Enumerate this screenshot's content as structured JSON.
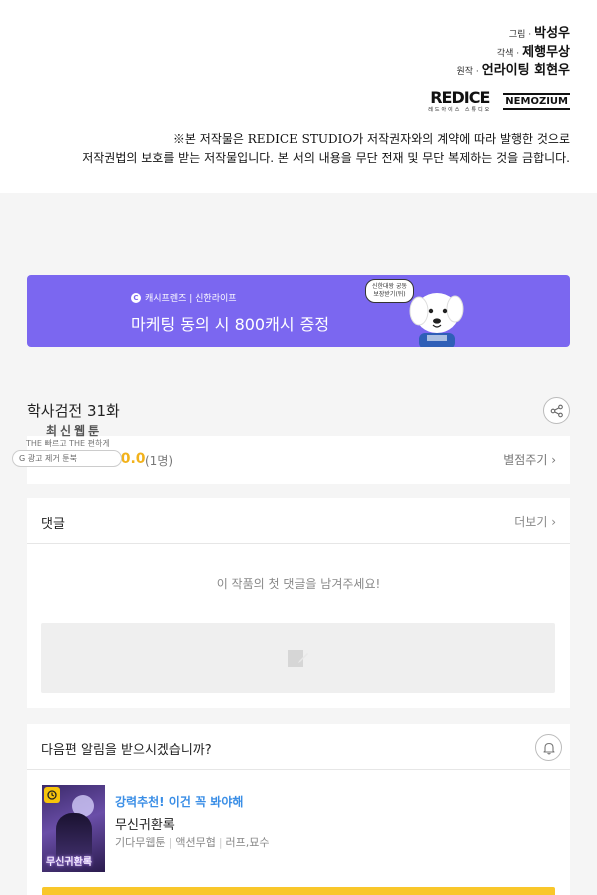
{
  "credits": {
    "lines": [
      {
        "role": "그림 ·",
        "name": "박성우"
      },
      {
        "role": "각색 ·",
        "name": "제행무상"
      },
      {
        "role": "원작 ·",
        "name": "언라이팅 회현우"
      }
    ],
    "logo_redice": "REDICE",
    "logo_redice_sub": "레드아이스 스튜디오",
    "logo_nemo": "NEMOZIUM",
    "copyright_line1": "※본 저작물은 REDICE STUDIO가 저작권자와의 계약에 따라 발행한 것으로",
    "copyright_line2": "저작권법의 보호를 받는 저작물입니다. 본 서의 내용을 무단 전재 및 무단 복제하는 것을 금합니다."
  },
  "banner": {
    "small_text": "캐시프렌즈 | 신한라이프",
    "big_text": "마케팅 동의 시 800캐시 증정",
    "bubble_text_1": "신한대왕 궁동",
    "bubble_text_2": "보장받기(뒤)",
    "background": "#7b67f0"
  },
  "episode": {
    "title": "학사검전 31화"
  },
  "floating_badge": {
    "line1": "최신웹툰",
    "line2_a": "THE 빠르고 THE 편하게",
    "pill_text": "G 광고 제거 툰북",
    "pill_icon": "G"
  },
  "rating": {
    "stars": "★★★★★",
    "score": "10.0",
    "count": "(1명)",
    "rate_link": "별점주기 ›",
    "star_color": "#f2b21b"
  },
  "comments": {
    "title": "댓글",
    "more": "더보기 ›",
    "empty_text": "이 작품의 첫 댓글을 남겨주세요!"
  },
  "notify": {
    "question": "다음편 알림을 받으시겠습니까?",
    "recommend_tag": "강력추천! 이건 꼭 봐야해",
    "recommend_name": "무신귀환록",
    "meta": [
      "기다무웹툰",
      "액션무협",
      "러프,묘수"
    ],
    "thumb_title": "무신귀환록",
    "tag_color": "#3a8ee6"
  }
}
